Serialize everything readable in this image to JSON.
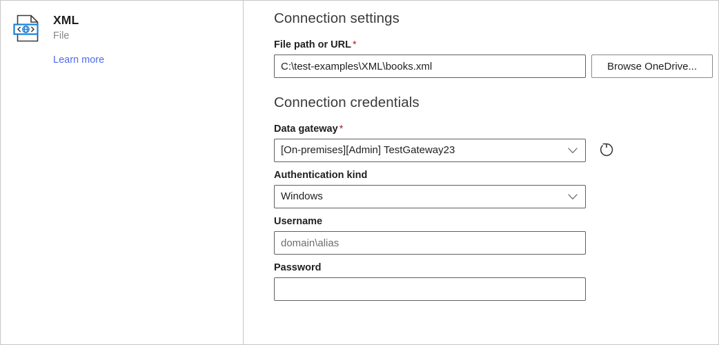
{
  "connector": {
    "icon": "xml-file-icon",
    "title": "XML",
    "subtitle": "File",
    "learn_more_label": "Learn more",
    "learn_more_color": "#4f6bed"
  },
  "sections": {
    "connection_settings": {
      "heading": "Connection settings",
      "file_path": {
        "label": "File path or URL",
        "required_marker": "*",
        "value": "C:\\test-examples\\XML\\books.xml",
        "placeholder": "",
        "browse_button_label": "Browse OneDrive..."
      }
    },
    "connection_credentials": {
      "heading": "Connection credentials",
      "data_gateway": {
        "label": "Data gateway",
        "required_marker": "*",
        "selected": "[On-premises][Admin] TestGateway23",
        "dropdown_icon": "chevron-down-icon",
        "refresh_icon": "refresh-icon",
        "refresh_tooltip": "Refresh"
      },
      "authentication_kind": {
        "label": "Authentication kind",
        "selected": "Windows",
        "dropdown_icon": "chevron-down-icon"
      },
      "username": {
        "label": "Username",
        "value": "",
        "placeholder": "domain\\alias"
      },
      "password": {
        "label": "Password",
        "value": "",
        "placeholder": ""
      }
    }
  },
  "theme": {
    "required_asterisk_color": "#a4262c",
    "heading_color": "#3b3a39",
    "label_color": "#201f1e",
    "border_color": "#605e5c",
    "panel_divider_color": "#c8c6c4",
    "accent_blue": "#0078d4"
  }
}
